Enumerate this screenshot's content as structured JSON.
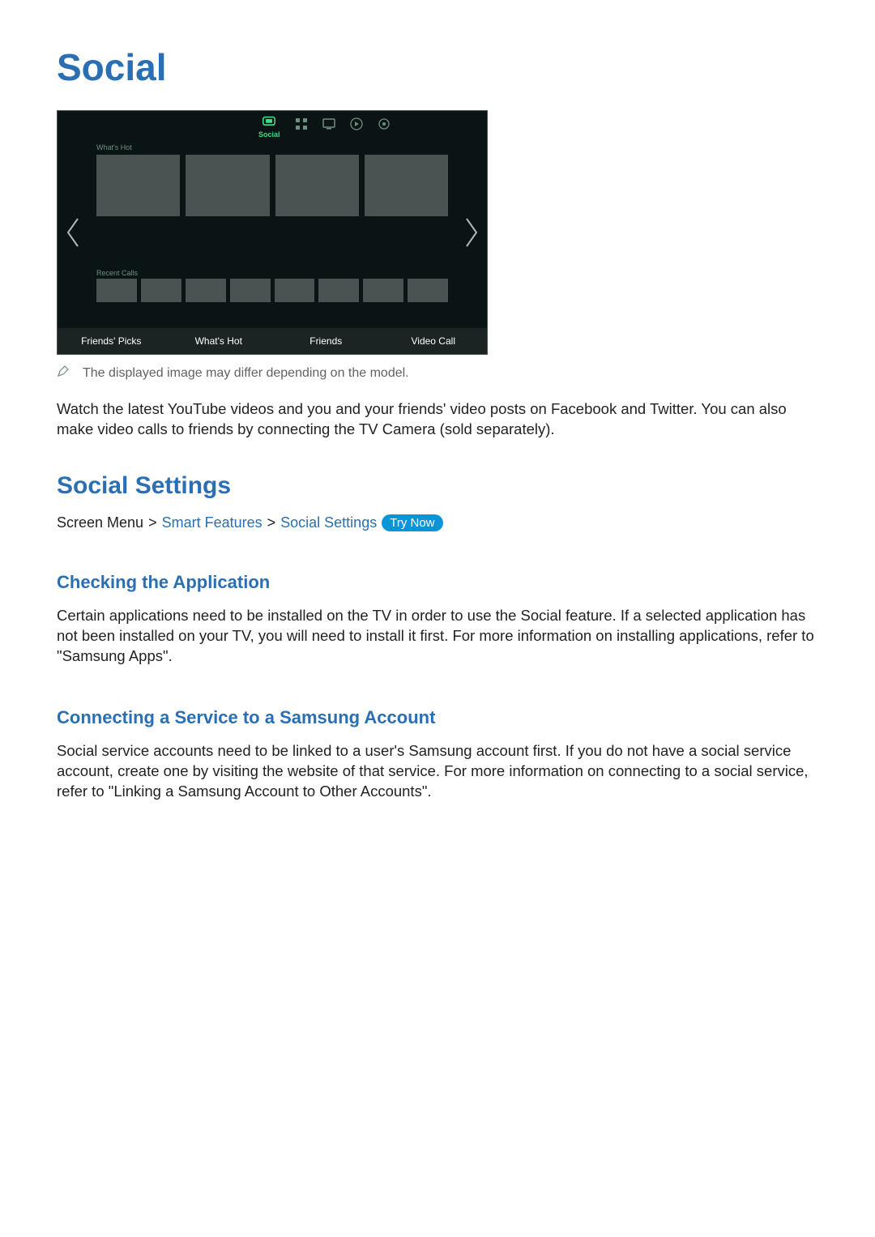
{
  "title": "Social",
  "tv": {
    "active_icon_label": "Social",
    "section_whats_hot": "What's Hot",
    "section_recent_calls": "Recent Calls",
    "bottom": {
      "friends_picks": "Friends' Picks",
      "whats_hot": "What's Hot",
      "friends": "Friends",
      "video_call": "Video Call"
    }
  },
  "note": "The displayed image may differ depending on the model.",
  "intro": "Watch the latest YouTube videos and you and your friends' video posts on Facebook and Twitter. You can also make video calls to friends by connecting the TV Camera (sold separately).",
  "settings_heading": "Social Settings",
  "breadcrumb": {
    "screen_menu": "Screen Menu",
    "sep": ">",
    "smart_features": "Smart Features",
    "social_settings": "Social Settings",
    "try_now": "Try Now"
  },
  "checking_heading": "Checking the Application",
  "checking_body": "Certain applications need to be installed on the TV in order to use the Social feature. If a selected application has not been installed on your TV, you will need to install it first. For more information on installing applications, refer to \"Samsung Apps\".",
  "connecting_heading": "Connecting a Service to a Samsung Account",
  "connecting_body": "Social service accounts need to be linked to a user's Samsung account first. If you do not have a social service account, create one by visiting the website of that service. For more information on connecting to a social service, refer to \"Linking a Samsung Account to Other Accounts\"."
}
